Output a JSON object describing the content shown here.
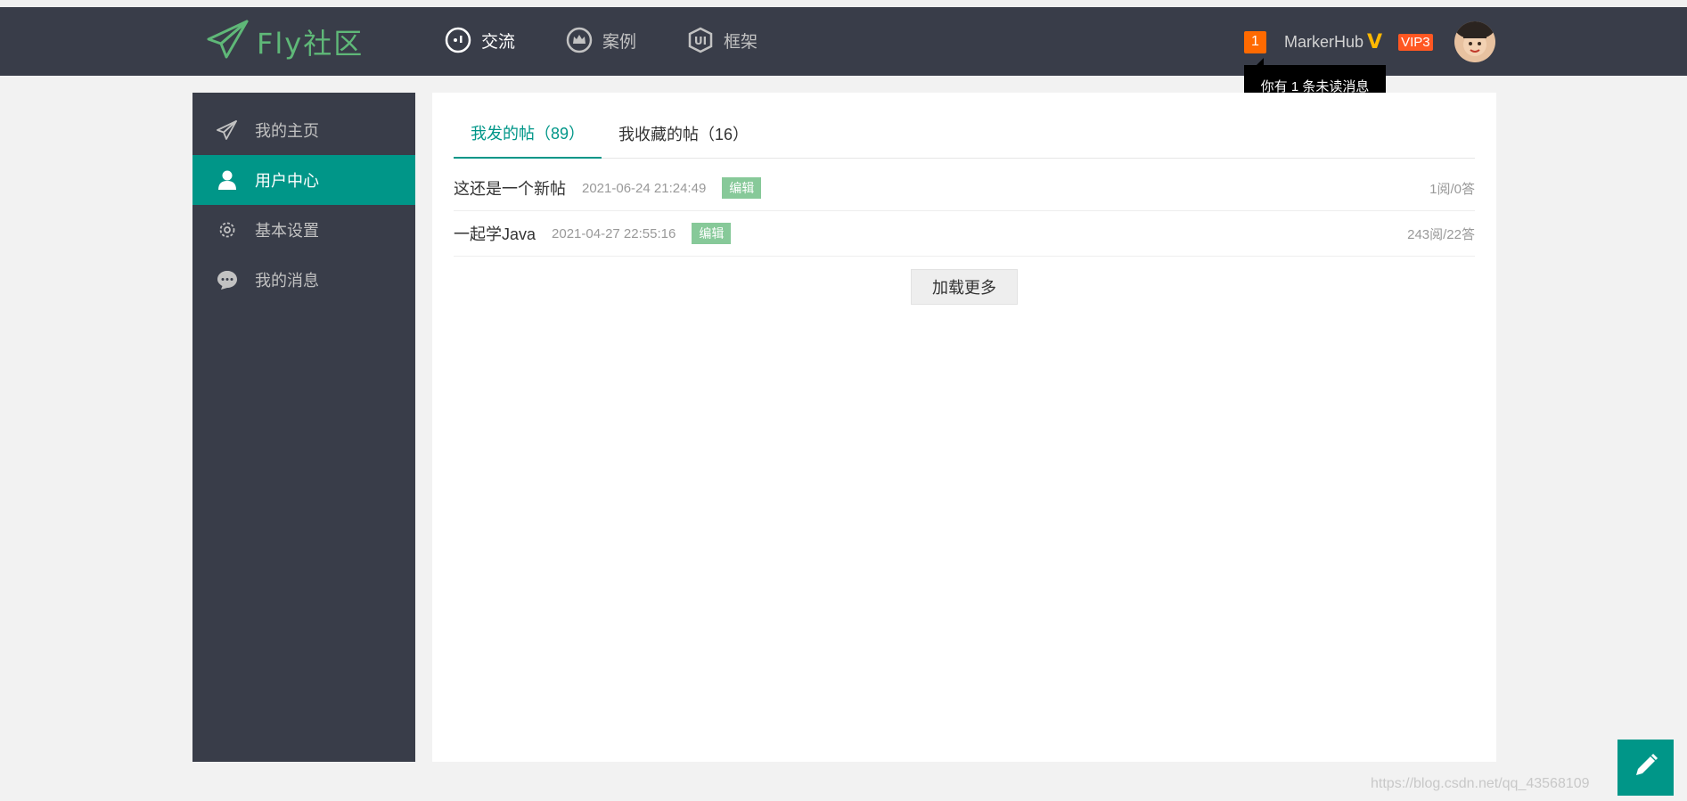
{
  "header": {
    "logo_text": "Fly社区",
    "nav": [
      {
        "label": "交流",
        "icon": "chat-bubble-icon"
      },
      {
        "label": "案例",
        "icon": "crown-icon"
      },
      {
        "label": "框架",
        "icon": "ui-shield-icon"
      }
    ],
    "message_count": "1",
    "username": "MarkerHub",
    "verified_mark": "V",
    "vip_label": "VIP3",
    "tooltip": "你有 1 条未读消息"
  },
  "sidebar": {
    "items": [
      {
        "label": "我的主页",
        "icon": "paper-plane-icon"
      },
      {
        "label": "用户中心",
        "icon": "user-icon"
      },
      {
        "label": "基本设置",
        "icon": "gear-icon"
      },
      {
        "label": "我的消息",
        "icon": "message-bubble-icon"
      }
    ],
    "active": "用户中心"
  },
  "main": {
    "tabs": [
      {
        "label": "我发的帖（89）"
      },
      {
        "label": "我收藏的帖（16）"
      }
    ],
    "posts": [
      {
        "title": "这还是一个新帖",
        "time": "2021-06-24 21:24:49",
        "edit": "编辑",
        "stats": "1阅/0答"
      },
      {
        "title": "一起学Java",
        "time": "2021-04-27 22:55:16",
        "edit": "编辑",
        "stats": "243阅/22答"
      }
    ],
    "load_more": "加载更多"
  },
  "watermark": "https://blog.csdn.net/qq_43568109",
  "colors": {
    "header_bg": "#393d49",
    "accent": "#009688",
    "logo_green": "#5fb878",
    "badge_orange": "#ff6a00",
    "vip_red": "#ff5722",
    "verified_gold": "#ffb800"
  }
}
